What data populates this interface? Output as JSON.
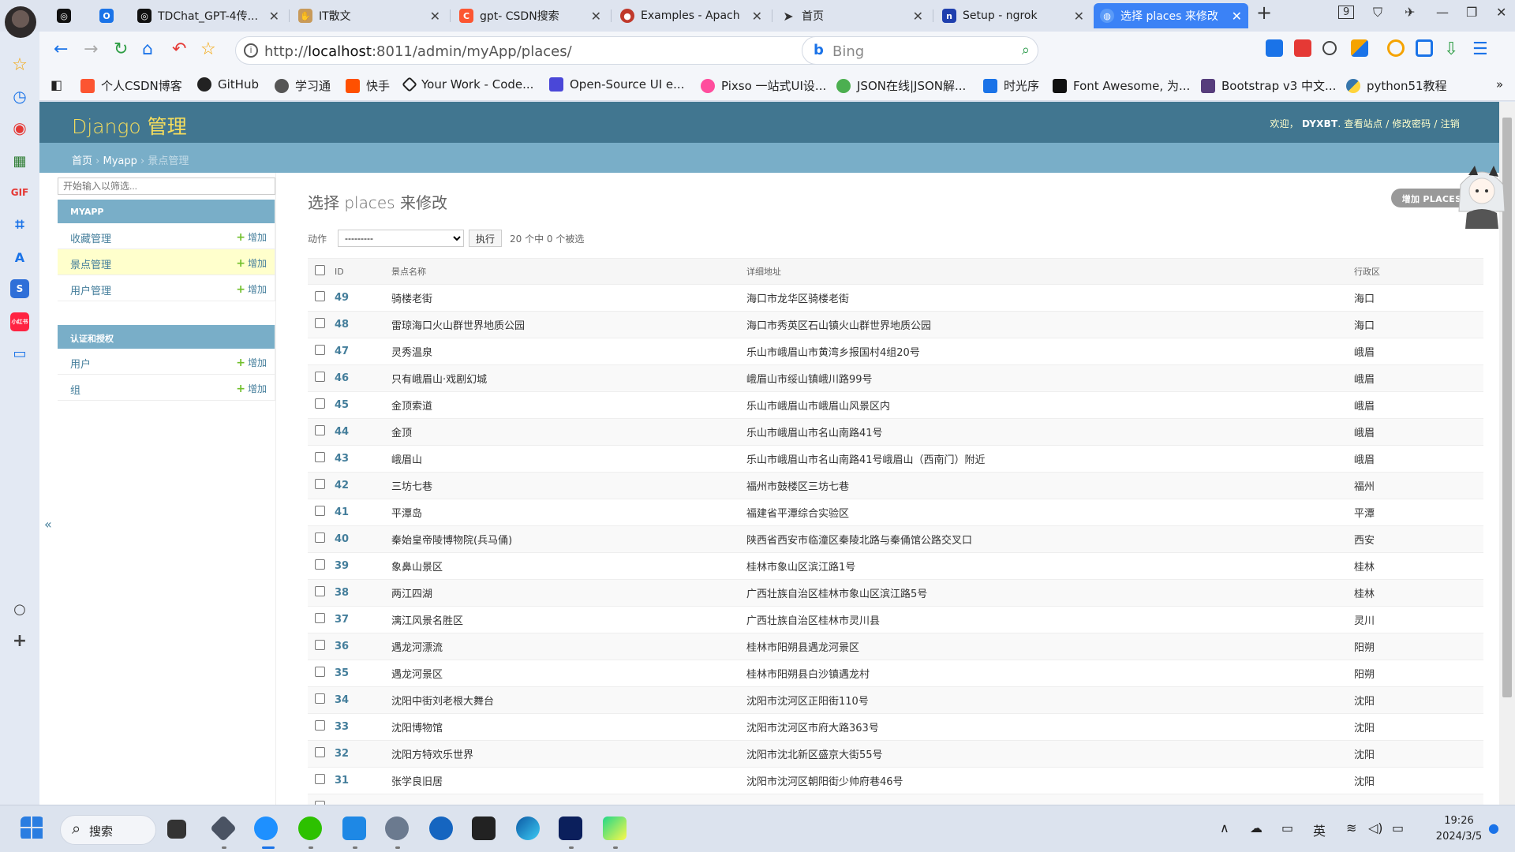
{
  "tabs": [
    {
      "label": "",
      "icon": "openai-icon",
      "color": "#111111"
    },
    {
      "label": "",
      "icon": "tab-icon",
      "color": "#1a73e8"
    },
    {
      "label": "TDChat_GPT-4传...",
      "icon": "openai-icon",
      "color": "#111111"
    },
    {
      "label": "IT散文",
      "icon": "hand-icon",
      "color": "#c89a5a"
    },
    {
      "label": "gpt- CSDN搜索",
      "icon": "csdn-icon",
      "color": "#fc5531"
    },
    {
      "label": "Examples - Apach",
      "icon": "record-icon",
      "color": "#c0392b"
    },
    {
      "label": "首页",
      "icon": "paper-plane-icon",
      "color": "#333333"
    },
    {
      "label": "Setup - ngrok",
      "icon": "ngrok-icon",
      "color": "#1f3fae"
    },
    {
      "label": "选择 places 来修改",
      "icon": "globe-icon",
      "color": "#3b82f6",
      "active": true
    }
  ],
  "tab_count": "9",
  "address": {
    "url_prefix": "http://",
    "url_host": "localhost",
    "url_rest": ":8011/admin/myApp/places/",
    "search_engine": "Bing"
  },
  "bookmarks": [
    "个人CSDN博客",
    "GitHub",
    "学习通",
    "快手",
    "Your Work - Code...",
    "Open-Source UI e...",
    "Pixso 一站式UI设...",
    "JSON在线|JSON解...",
    "时光序",
    "Font Awesome, 为...",
    "Bootstrap v3 中文...",
    "python51教程"
  ],
  "header": {
    "brand": "Django 管理",
    "welcome": "欢迎，",
    "user": "DYXBT",
    "view_site": "查看站点",
    "change_password": "修改密码",
    "logout": "注销"
  },
  "breadcrumbs": {
    "home": "首页",
    "app": "Myapp",
    "current": "景点管理",
    "sep": "›"
  },
  "nav": {
    "filter_placeholder": "开始输入以筛选...",
    "add_label": "增加",
    "modules": [
      {
        "caption": "MYAPP",
        "items": [
          "收藏管理",
          "景点管理",
          "用户管理"
        ]
      },
      {
        "caption": "认证和授权",
        "items": [
          "用户",
          "组"
        ]
      }
    ]
  },
  "content": {
    "title": "选择 places 来修改",
    "add_button": "增加 PLACES",
    "action_label": "动作",
    "action_default": "---------",
    "go_button": "执行",
    "selection_count": "20 个中 0 个被选",
    "columns": [
      "ID",
      "景点名称",
      "详细地址",
      "行政区"
    ]
  },
  "rows": [
    {
      "id": "49",
      "name": "骑楼老街",
      "address": "海口市龙华区骑楼老街",
      "district": "海口"
    },
    {
      "id": "48",
      "name": "雷琼海口火山群世界地质公园",
      "address": "海口市秀英区石山镇火山群世界地质公园",
      "district": "海口"
    },
    {
      "id": "47",
      "name": "灵秀温泉",
      "address": "乐山市峨眉山市黄湾乡报国村4组20号",
      "district": "峨眉"
    },
    {
      "id": "46",
      "name": "只有峨眉山·戏剧幻城",
      "address": "峨眉山市绥山镇峨川路99号",
      "district": "峨眉"
    },
    {
      "id": "45",
      "name": "金顶索道",
      "address": "乐山市峨眉山市峨眉山风景区内",
      "district": "峨眉"
    },
    {
      "id": "44",
      "name": "金顶",
      "address": "乐山市峨眉山市名山南路41号",
      "district": "峨眉"
    },
    {
      "id": "43",
      "name": "峨眉山",
      "address": "乐山市峨眉山市名山南路41号峨眉山（西南门）附近",
      "district": "峨眉"
    },
    {
      "id": "42",
      "name": "三坊七巷",
      "address": "福州市鼓楼区三坊七巷",
      "district": "福州"
    },
    {
      "id": "41",
      "name": "平潭岛",
      "address": "福建省平潭综合实验区",
      "district": "平潭"
    },
    {
      "id": "40",
      "name": "秦始皇帝陵博物院(兵马俑)",
      "address": "陕西省西安市临潼区秦陵北路与秦俑馆公路交叉口",
      "district": "西安"
    },
    {
      "id": "39",
      "name": "象鼻山景区",
      "address": "桂林市象山区滨江路1号",
      "district": "桂林"
    },
    {
      "id": "38",
      "name": "两江四湖",
      "address": "广西壮族自治区桂林市象山区滨江路5号",
      "district": "桂林"
    },
    {
      "id": "37",
      "name": "漓江风景名胜区",
      "address": "广西壮族自治区桂林市灵川县",
      "district": "灵川"
    },
    {
      "id": "36",
      "name": "遇龙河漂流",
      "address": "桂林市阳朔县遇龙河景区",
      "district": "阳朔"
    },
    {
      "id": "35",
      "name": "遇龙河景区",
      "address": "桂林市阳朔县白沙镇遇龙村",
      "district": "阳朔"
    },
    {
      "id": "34",
      "name": "沈阳中街刘老根大舞台",
      "address": "沈阳市沈河区正阳街110号",
      "district": "沈阳"
    },
    {
      "id": "33",
      "name": "沈阳博物馆",
      "address": "沈阳市沈河区市府大路363号",
      "district": "沈阳"
    },
    {
      "id": "32",
      "name": "沈阳方特欢乐世界",
      "address": "沈阳市沈北新区盛京大街55号",
      "district": "沈阳"
    },
    {
      "id": "31",
      "name": "张学良旧居",
      "address": "沈阳市沈河区朝阳街少帅府巷46号",
      "district": "沈阳"
    },
    {
      "id": "",
      "name": "",
      "address": "",
      "district": ""
    }
  ],
  "taskbar": {
    "search_label": "搜索",
    "ime": "英",
    "time": "19:26",
    "date": "2024/3/5"
  },
  "colors": {
    "django_header": "#417690",
    "breadcrumb_bar": "#79aec8",
    "brand_text": "#f5dd5d",
    "link": "#447e9b",
    "add_plus": "#70bf2b",
    "active_tab": "#3b82f6"
  }
}
